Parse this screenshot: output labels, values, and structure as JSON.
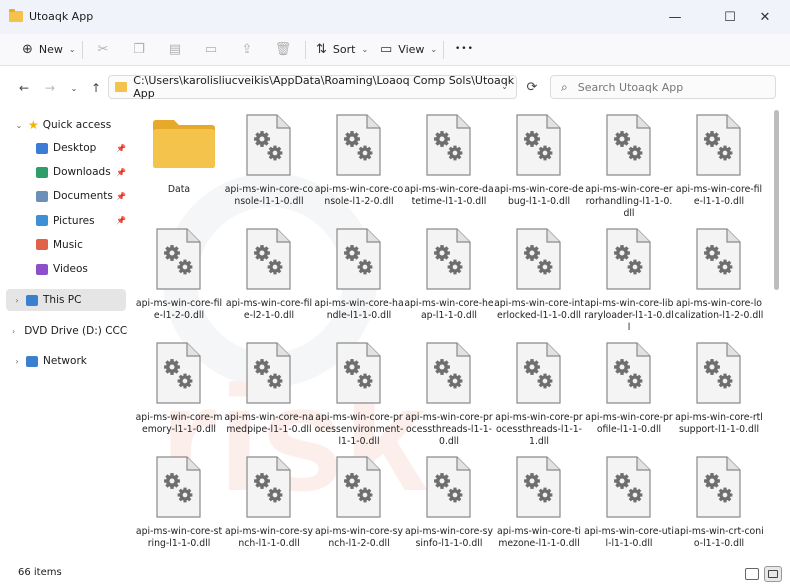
{
  "window": {
    "title": "Utoaqk App",
    "minimize_glyph": "—",
    "maximize_glyph": "☐",
    "close_glyph": "✕"
  },
  "toolbar": {
    "new_label": "New",
    "sort_label": "Sort",
    "view_label": "View",
    "more_glyph": "•••"
  },
  "address": {
    "path": "C:\\Users\\karolisliucveikis\\AppData\\Roaming\\Loaoq Comp Sols\\Utoaqk App",
    "search_placeholder": "Search Utoaqk App"
  },
  "sidebar": {
    "quick_access": "Quick access",
    "items": [
      {
        "label": "Desktop",
        "icon": "desktop-icon",
        "color": "#3a7bd5",
        "pinned": true
      },
      {
        "label": "Downloads",
        "icon": "downloads-icon",
        "color": "#2f9d6a",
        "pinned": true
      },
      {
        "label": "Documents",
        "icon": "documents-icon",
        "color": "#6c8fb8",
        "pinned": true
      },
      {
        "label": "Pictures",
        "icon": "pictures-icon",
        "color": "#3d8fd6",
        "pinned": true
      },
      {
        "label": "Music",
        "icon": "music-icon",
        "color": "#e0604a",
        "pinned": false
      },
      {
        "label": "Videos",
        "icon": "videos-icon",
        "color": "#8d4fc9",
        "pinned": false
      }
    ],
    "this_pc": "This PC",
    "dvd_drive": "DVD Drive (D:) CCCC",
    "network": "Network"
  },
  "files": [
    {
      "name": "Data",
      "type": "folder"
    },
    {
      "name": "api-ms-win-core-console-l1-1-0.dll",
      "type": "dll"
    },
    {
      "name": "api-ms-win-core-console-l1-2-0.dll",
      "type": "dll"
    },
    {
      "name": "api-ms-win-core-datetime-l1-1-0.dll",
      "type": "dll"
    },
    {
      "name": "api-ms-win-core-debug-l1-1-0.dll",
      "type": "dll"
    },
    {
      "name": "api-ms-win-core-errorhandling-l1-1-0.dll",
      "type": "dll"
    },
    {
      "name": "api-ms-win-core-file-l1-1-0.dll",
      "type": "dll"
    },
    {
      "name": "api-ms-win-core-file-l1-2-0.dll",
      "type": "dll"
    },
    {
      "name": "api-ms-win-core-file-l2-1-0.dll",
      "type": "dll"
    },
    {
      "name": "api-ms-win-core-handle-l1-1-0.dll",
      "type": "dll"
    },
    {
      "name": "api-ms-win-core-heap-l1-1-0.dll",
      "type": "dll"
    },
    {
      "name": "api-ms-win-core-interlocked-l1-1-0.dll",
      "type": "dll"
    },
    {
      "name": "api-ms-win-core-libraryloader-l1-1-0.dll",
      "type": "dll"
    },
    {
      "name": "api-ms-win-core-localization-l1-2-0.dll",
      "type": "dll"
    },
    {
      "name": "api-ms-win-core-memory-l1-1-0.dll",
      "type": "dll"
    },
    {
      "name": "api-ms-win-core-namedpipe-l1-1-0.dll",
      "type": "dll"
    },
    {
      "name": "api-ms-win-core-processenvironment-l1-1-0.dll",
      "type": "dll"
    },
    {
      "name": "api-ms-win-core-processthreads-l1-1-0.dll",
      "type": "dll"
    },
    {
      "name": "api-ms-win-core-processthreads-l1-1-1.dll",
      "type": "dll"
    },
    {
      "name": "api-ms-win-core-profile-l1-1-0.dll",
      "type": "dll"
    },
    {
      "name": "api-ms-win-core-rtlsupport-l1-1-0.dll",
      "type": "dll"
    },
    {
      "name": "api-ms-win-core-string-l1-1-0.dll",
      "type": "dll"
    },
    {
      "name": "api-ms-win-core-synch-l1-1-0.dll",
      "type": "dll"
    },
    {
      "name": "api-ms-win-core-synch-l1-2-0.dll",
      "type": "dll"
    },
    {
      "name": "api-ms-win-core-sysinfo-l1-1-0.dll",
      "type": "dll"
    },
    {
      "name": "api-ms-win-core-timezone-l1-1-0.dll",
      "type": "dll"
    },
    {
      "name": "api-ms-win-core-util-l1-1-0.dll",
      "type": "dll"
    },
    {
      "name": "api-ms-win-crt-conio-l1-1-0.dll",
      "type": "dll"
    }
  ],
  "status": {
    "count": "66 items"
  },
  "colors": {
    "folder": "#f3c34b",
    "accent": "#0067c0"
  }
}
